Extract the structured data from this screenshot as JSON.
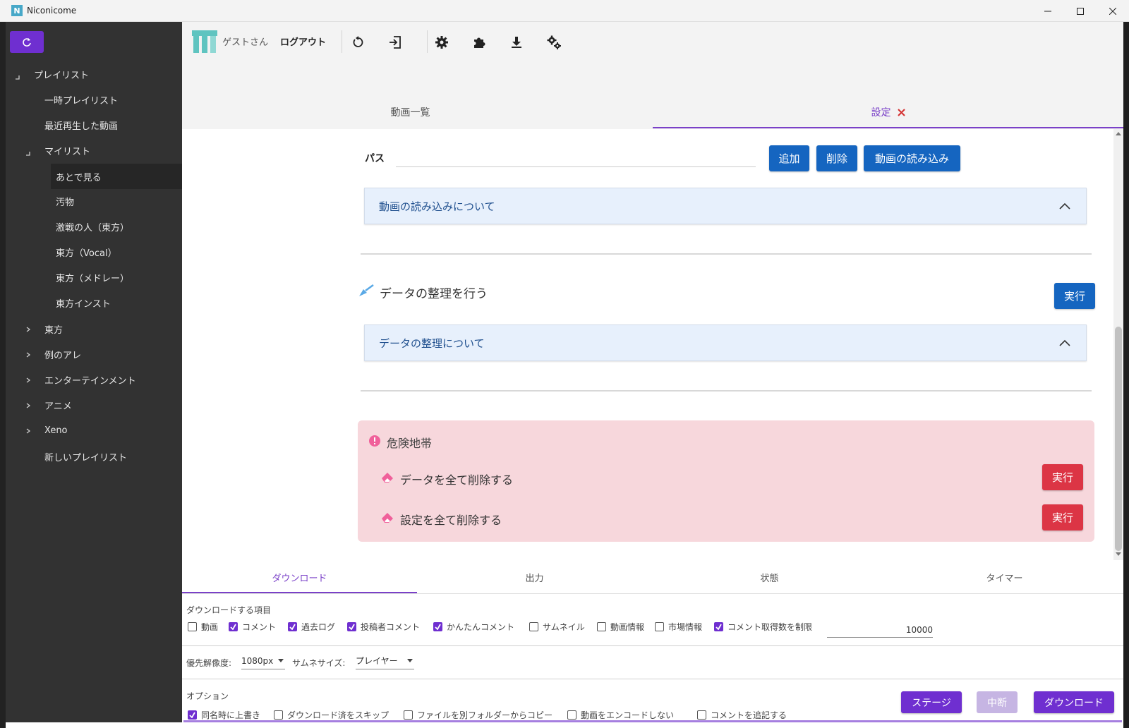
{
  "window": {
    "title": "Niconicome",
    "icon_letter": "N"
  },
  "sidebar": {
    "items": [
      {
        "label": "プレイリスト",
        "arrow": "expanded"
      },
      {
        "label": "一時プレイリスト"
      },
      {
        "label": "最近再生した動画"
      },
      {
        "label": "マイリスト",
        "arrow": "expanded"
      },
      {
        "label": "あとで見る"
      },
      {
        "label": "汚物"
      },
      {
        "label": "激戦の人（東方）"
      },
      {
        "label": "東方（Vocal）"
      },
      {
        "label": "東方（メドレー）"
      },
      {
        "label": "東方インスト"
      },
      {
        "label": "東方",
        "arrow": "collapsed"
      },
      {
        "label": "例のアレ",
        "arrow": "collapsed"
      },
      {
        "label": "エンターテインメント",
        "arrow": "collapsed"
      },
      {
        "label": "アニメ",
        "arrow": "collapsed"
      },
      {
        "label": "Xeno",
        "arrow": "collapsed"
      },
      {
        "label": "新しいプレイリスト"
      }
    ]
  },
  "toolbar": {
    "user": "ゲストさん",
    "logout": "ログアウト"
  },
  "tabs": {
    "videos": "動画一覧",
    "settings": "設定"
  },
  "settings": {
    "path_label": "パス",
    "add": "追加",
    "delete": "削除",
    "load_videos": "動画の読み込み",
    "about_load": "動画の読み込みについて",
    "cleanup_title": "データの整理を行う",
    "run": "実行",
    "about_cleanup": "データの整理について",
    "danger_title": "危険地帯",
    "delete_all_data": "データを全て削除する",
    "delete_all_settings": "設定を全て削除する"
  },
  "bottom_tabs": {
    "download": "ダウンロード",
    "output": "出力",
    "status": "状態",
    "timer": "タイマー"
  },
  "download": {
    "items_label": "ダウンロードする項目",
    "items": [
      {
        "label": "動画",
        "checked": false
      },
      {
        "label": "コメント",
        "checked": true
      },
      {
        "label": "過去ログ",
        "checked": true
      },
      {
        "label": "投稿者コメント",
        "checked": true
      },
      {
        "label": "かんたんコメント",
        "checked": true
      },
      {
        "label": "サムネイル",
        "checked": false
      },
      {
        "label": "動画情報",
        "checked": false
      },
      {
        "label": "市場情報",
        "checked": false
      },
      {
        "label": "コメント取得数を制限",
        "checked": true
      }
    ],
    "comment_limit": "10000",
    "resolution_label": "優先解像度:",
    "resolution": "1080px",
    "thumb_label": "サムネサイズ:",
    "thumb": "プレイヤー",
    "options_label": "オプション",
    "options": [
      {
        "label": "同名時に上書き",
        "checked": true
      },
      {
        "label": "ダウンロード済をスキップ",
        "checked": false
      },
      {
        "label": "ファイルを別フォルダーからコピー",
        "checked": false
      },
      {
        "label": "動画をエンコードしない",
        "checked": false
      },
      {
        "label": "コメントを追記する",
        "checked": false
      }
    ],
    "stage": "ステージ",
    "abort": "中断",
    "download": "ダウンロード"
  },
  "colors": {
    "accent": "#6f2fd0",
    "primary": "#1565c0",
    "danger": "#dc3545",
    "sidebar": "#323232"
  }
}
